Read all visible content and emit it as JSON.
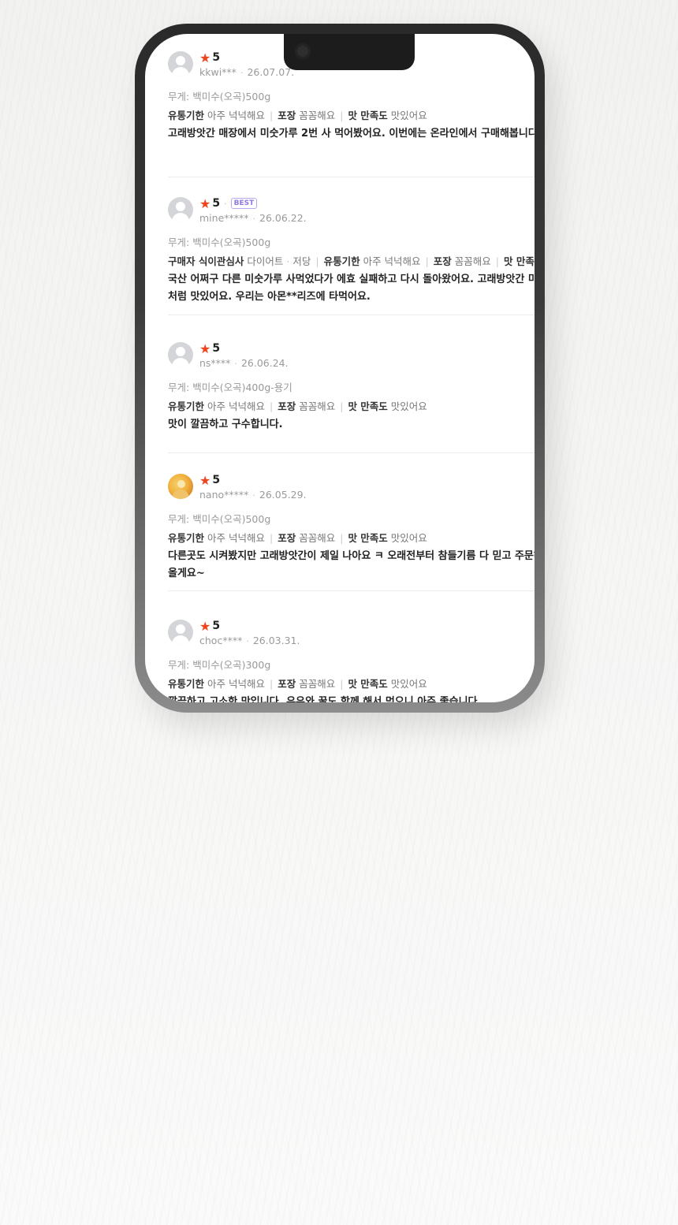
{
  "reviews": [
    {
      "rating": "5",
      "best": "",
      "user": "kkwi***",
      "date": "26.07.07.",
      "option_label": "무게:",
      "option_value": "백미수(오곡)500g",
      "tags": [
        {
          "key": "유통기한",
          "value": "아주 넉넉해요"
        },
        {
          "key": "포장",
          "value": "꼼꼼해요"
        },
        {
          "key": "맛 만족도",
          "value": "맛있어요"
        }
      ],
      "text_lines": [
        "고래방앗간 매장에서 미숫가루 2번 사 먹어봤어요. 이번에는 온라인에서 구매해봅니다"
      ]
    },
    {
      "rating": "5",
      "best": "BEST",
      "user": "mine*****",
      "date": "26.06.22.",
      "option_label": "무게:",
      "option_value": "백미수(오곡)500g",
      "extra_tag": {
        "key": "구매자 식이관심사",
        "values": [
          "다이어트",
          "저당"
        ]
      },
      "tags": [
        {
          "key": "유통기한",
          "value": "아주 넉넉해요"
        },
        {
          "key": "포장",
          "value": "꼼꼼해요"
        },
        {
          "key": "맛 만족도",
          "value": ""
        }
      ],
      "text_lines": [
        "국산 어쩌구 다른 미숫가루 사먹었다가 에효 실패하고 다시 돌아왔어요. 고래방앗간 미숫가루",
        "처럼 맛있어요. 우리는 아몬**리즈에 타먹어요."
      ]
    },
    {
      "rating": "5",
      "best": "",
      "user": "ns****",
      "date": "26.06.24.",
      "option_label": "무게:",
      "option_value": "백미수(오곡)400g-용기",
      "tags": [
        {
          "key": "유통기한",
          "value": "아주 넉넉해요"
        },
        {
          "key": "포장",
          "value": "꼼꼼해요"
        },
        {
          "key": "맛 만족도",
          "value": "맛있어요"
        }
      ],
      "text_lines": [
        "맛이 깔끔하고 구수합니다."
      ]
    },
    {
      "rating": "5",
      "best": "",
      "user": "nano*****",
      "date": "26.05.29.",
      "option_label": "무게:",
      "option_value": "백미수(오곡)500g",
      "avatar_photo": true,
      "tags": [
        {
          "key": "유통기한",
          "value": "아주 넉넉해요"
        },
        {
          "key": "포장",
          "value": "꼼꼼해요"
        },
        {
          "key": "맛 만족도",
          "value": "맛있어요"
        }
      ],
      "text_lines": [
        "다른곳도 시켜봤지만 고래방앗간이 제일 나아요 ㅋ 오래전부터 참들기름 다 믿고 주문해요",
        "올게요~"
      ]
    },
    {
      "rating": "5",
      "best": "",
      "user": "choc****",
      "date": "26.03.31.",
      "option_label": "무게:",
      "option_value": "백미수(오곡)300g",
      "tags": [
        {
          "key": "유통기한",
          "value": "아주 넉넉해요"
        },
        {
          "key": "포장",
          "value": "꼼꼼해요"
        },
        {
          "key": "맛 만족도",
          "value": "맛있어요"
        }
      ],
      "text_lines": [
        "깔끔하고 고소한 맛입니다. 우유와 꿀도 함께 해서 먹으니 아주 좋습니다."
      ]
    }
  ],
  "icons": {
    "star": "★",
    "separator": "·"
  },
  "colors": {
    "star": "#f0441e",
    "best_badge": "#8f78e0"
  }
}
